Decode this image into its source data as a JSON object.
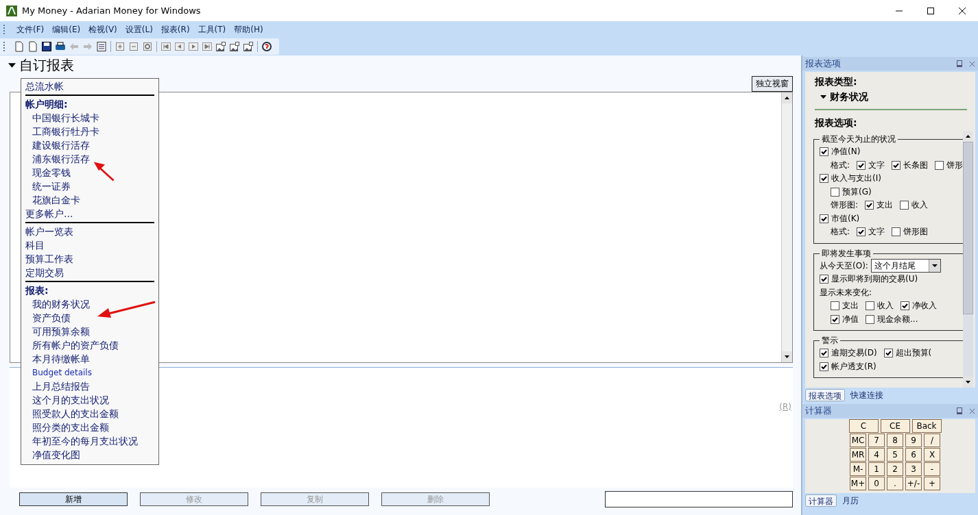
{
  "window": {
    "title": "My Money - Adarian Money for Windows"
  },
  "menu": [
    "文件(F)",
    "编辑(E)",
    "检视(V)",
    "设置(L)",
    "报表(R)",
    "工具(T)",
    "帮助(H)"
  ],
  "report": {
    "heading": "自订报表",
    "popout_button": "独立视窗",
    "side_label": "(R)"
  },
  "report_menu": [
    {
      "items": [
        {
          "kind": "item",
          "label": "总流水帐"
        }
      ]
    },
    {
      "items": [
        {
          "kind": "header",
          "label": "帐户明细:"
        },
        {
          "kind": "sub",
          "label": "中国银行长城卡"
        },
        {
          "kind": "sub",
          "label": "工商银行牡丹卡"
        },
        {
          "kind": "sub",
          "label": "建设银行活存"
        },
        {
          "kind": "sub",
          "label": "浦东银行活存"
        },
        {
          "kind": "sub",
          "label": "现金零钱"
        },
        {
          "kind": "sub",
          "label": "统一证券"
        },
        {
          "kind": "sub",
          "label": "花旗白金卡"
        },
        {
          "kind": "item",
          "label": "更多帐户..."
        }
      ]
    },
    {
      "items": [
        {
          "kind": "item",
          "label": "帐户一览表"
        },
        {
          "kind": "item",
          "label": "科目"
        },
        {
          "kind": "item",
          "label": "预算工作表"
        },
        {
          "kind": "item",
          "label": "定期交易"
        }
      ]
    },
    {
      "items": [
        {
          "kind": "header",
          "label": "报表:"
        },
        {
          "kind": "sub",
          "label": "我的财务状况"
        },
        {
          "kind": "sub",
          "label": "资产负债"
        },
        {
          "kind": "sub",
          "label": "可用预算余额"
        },
        {
          "kind": "sub",
          "label": "所有帐户的资产负债"
        },
        {
          "kind": "sub",
          "label": "本月待缴帐单"
        },
        {
          "kind": "link",
          "label": "Budget details"
        },
        {
          "kind": "sub",
          "label": "上月总结报告"
        },
        {
          "kind": "sub",
          "label": "这个月的支出状况"
        },
        {
          "kind": "sub",
          "label": "照受款人的支出金额"
        },
        {
          "kind": "sub",
          "label": "照分类的支出金额"
        },
        {
          "kind": "sub",
          "label": "年初至今的每月支出状况"
        },
        {
          "kind": "sub",
          "label": "净值变化图"
        }
      ]
    }
  ],
  "bottom_buttons": [
    {
      "label": "新增",
      "disabled": false
    },
    {
      "label": "修改",
      "disabled": true
    },
    {
      "label": "复制",
      "disabled": true
    },
    {
      "label": "删除",
      "disabled": true
    }
  ],
  "options_panel": {
    "title": "报表选项",
    "type_label": "报表类型:",
    "type_value": "财务状况",
    "options_label": "报表选项:",
    "groups": [
      {
        "title": "截至今天为止的状况",
        "rows": [
          {
            "kind": "row",
            "cells": [
              {
                "kind": "check",
                "label": "净值(N)",
                "checked": true
              }
            ]
          },
          {
            "kind": "subrow",
            "cells": [
              {
                "kind": "label",
                "text": "格式:"
              },
              {
                "kind": "check",
                "label": "文字",
                "checked": true
              },
              {
                "kind": "check",
                "label": "长条图",
                "checked": true
              },
              {
                "kind": "check",
                "label": "饼形",
                "checked": false
              }
            ]
          },
          {
            "kind": "row",
            "cells": [
              {
                "kind": "check",
                "label": "收入与支出(I)",
                "checked": true
              }
            ]
          },
          {
            "kind": "subrow",
            "cells": [
              {
                "kind": "check",
                "label": "预算(G)",
                "checked": false
              }
            ]
          },
          {
            "kind": "subrow",
            "cells": [
              {
                "kind": "label",
                "text": "饼形图:"
              },
              {
                "kind": "check",
                "label": "支出",
                "checked": true
              },
              {
                "kind": "check",
                "label": "收入",
                "checked": false
              }
            ]
          },
          {
            "kind": "row",
            "cells": [
              {
                "kind": "check",
                "label": "市值(K)",
                "checked": true
              }
            ]
          },
          {
            "kind": "subrow",
            "cells": [
              {
                "kind": "label",
                "text": "格式:"
              },
              {
                "kind": "check",
                "label": "文字",
                "checked": true
              },
              {
                "kind": "check",
                "label": "饼形图",
                "checked": false
              }
            ]
          }
        ]
      },
      {
        "title": "即将发生事项",
        "rows": [
          {
            "kind": "row",
            "cells": [
              {
                "kind": "label",
                "text": "从今天至(O):"
              },
              {
                "kind": "select",
                "value": "这个月结尾"
              }
            ]
          },
          {
            "kind": "row",
            "cells": [
              {
                "kind": "check",
                "label": "显示即将到期的交易(U)",
                "checked": true
              }
            ]
          },
          {
            "kind": "row",
            "cells": [
              {
                "kind": "label",
                "text": "显示未来变化:"
              }
            ]
          },
          {
            "kind": "subrow",
            "cells": [
              {
                "kind": "check",
                "label": "支出",
                "checked": false
              },
              {
                "kind": "check",
                "label": "收入",
                "checked": false
              },
              {
                "kind": "check",
                "label": "净收入",
                "checked": true
              }
            ]
          },
          {
            "kind": "subrow",
            "cells": [
              {
                "kind": "check",
                "label": "净值",
                "checked": true
              },
              {
                "kind": "check",
                "label": "现金余额...",
                "checked": false
              }
            ]
          }
        ]
      },
      {
        "title": "警示",
        "rows": [
          {
            "kind": "row",
            "cells": [
              {
                "kind": "check",
                "label": "逾期交易(D)",
                "checked": true
              },
              {
                "kind": "check",
                "label": "超出预算(",
                "checked": true
              }
            ]
          },
          {
            "kind": "row",
            "cells": [
              {
                "kind": "check",
                "label": "帐户透支(R)",
                "checked": true
              }
            ]
          }
        ]
      }
    ],
    "tabs": [
      {
        "label": "报表选项",
        "selected": true
      },
      {
        "label": "快速连接",
        "selected": false
      }
    ]
  },
  "calculator": {
    "title": "计算器",
    "top_keys": [
      "C",
      "CE",
      "Back"
    ],
    "rows": [
      [
        "MC",
        "7",
        "8",
        "9",
        "/"
      ],
      [
        "MR",
        "4",
        "5",
        "6",
        "X"
      ],
      [
        "M-",
        "1",
        "2",
        "3",
        "-"
      ],
      [
        "M+",
        "0",
        ".",
        "+/-",
        "+"
      ]
    ],
    "tabs": [
      {
        "label": "计算器",
        "selected": true
      },
      {
        "label": "月历",
        "selected": false
      }
    ]
  }
}
